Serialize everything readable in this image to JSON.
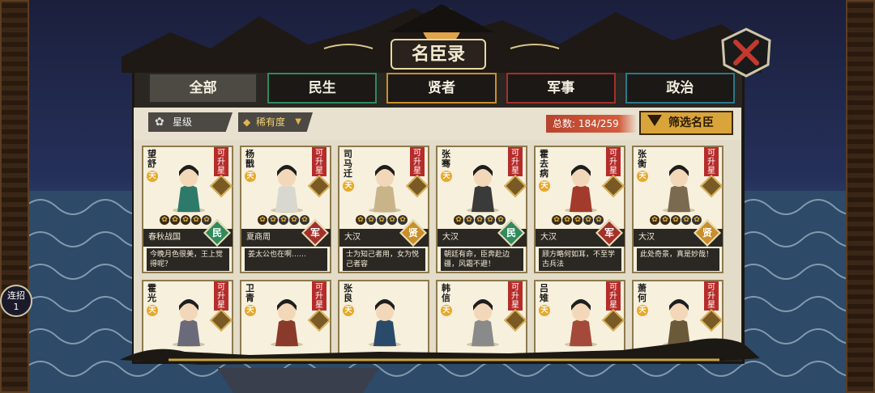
{
  "title": "名臣录",
  "tabs": [
    {
      "label": "全部",
      "color": "#2b2925",
      "active": true
    },
    {
      "label": "民生",
      "color": "#2f8a5c"
    },
    {
      "label": "贤者",
      "color": "#c98f2a"
    },
    {
      "label": "军事",
      "color": "#a3302a"
    },
    {
      "label": "政治",
      "color": "#2a7a8a"
    }
  ],
  "filters": {
    "star": "星级",
    "rarity": "稀有度"
  },
  "total": "总数: 184/259",
  "filter_button": "筛选名臣",
  "upgrade_label": "可升星",
  "tian": "天",
  "combo": {
    "label": "连招",
    "count": "1"
  },
  "cards": [
    {
      "name": "望舒",
      "stars": 5,
      "stars_on": 4,
      "era": "春秋战国",
      "cat": "民",
      "cat_color": "#2f8a5c",
      "quote": "今晚月色很美，王上觉得呢？",
      "upg": true
    },
    {
      "name": "杨戬",
      "stars": 5,
      "stars_on": 1,
      "era": "夏商周",
      "cat": "军",
      "cat_color": "#a3302a",
      "quote": "姜太公也在啊……",
      "upg": true
    },
    {
      "name": "司马迁",
      "stars": 5,
      "stars_on": 1,
      "era": "大汉",
      "cat": "贤",
      "cat_color": "#c98f2a",
      "quote": "士为知己者用，女为悦己者容",
      "upg": true
    },
    {
      "name": "张骞",
      "stars": 5,
      "stars_on": 1,
      "era": "大汉",
      "cat": "民",
      "cat_color": "#2f8a5c",
      "quote": "朝廷有命，臣奔赴边疆，风霜不避！",
      "upg": true
    },
    {
      "name": "霍去病",
      "stars": 5,
      "stars_on": 3,
      "era": "大汉",
      "cat": "军",
      "cat_color": "#a3302a",
      "quote": "顾方略何如耳，不至学古兵法",
      "upg": true
    },
    {
      "name": "张衡",
      "stars": 5,
      "stars_on": 3,
      "era": "大汉",
      "cat": "贤",
      "cat_color": "#c98f2a",
      "quote": "此处奇景，真是妙哉！",
      "upg": true
    },
    {
      "name": "霍光",
      "upg": true
    },
    {
      "name": "卫青",
      "upg": true
    },
    {
      "name": "张良",
      "upg": false
    },
    {
      "name": "韩信",
      "upg": true
    },
    {
      "name": "吕雉",
      "upg": true
    },
    {
      "name": "萧何",
      "upg": true
    }
  ]
}
